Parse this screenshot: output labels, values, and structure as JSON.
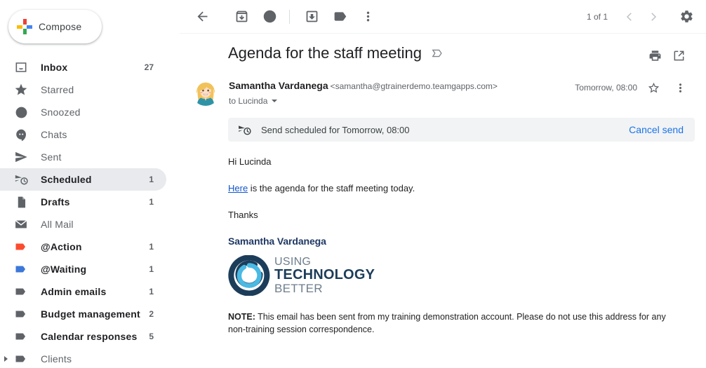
{
  "sidebar": {
    "compose": {
      "label": "Compose",
      "icon": "plus-icon"
    },
    "items": [
      {
        "label": "Inbox",
        "count": "27",
        "icon": "inbox-icon",
        "style": "bold",
        "expander": false
      },
      {
        "label": "Starred",
        "count": "",
        "icon": "star-icon",
        "style": "dim",
        "expander": false
      },
      {
        "label": "Snoozed",
        "count": "",
        "icon": "clock-icon",
        "style": "dim",
        "expander": false
      },
      {
        "label": "Chats",
        "count": "",
        "icon": "chat-icon",
        "style": "dim",
        "expander": false
      },
      {
        "label": "Sent",
        "count": "",
        "icon": "send-icon",
        "style": "dim",
        "expander": false
      },
      {
        "label": "Scheduled",
        "count": "1",
        "icon": "schedule-send-icon",
        "style": "bold selected",
        "expander": false
      },
      {
        "label": "Drafts",
        "count": "1",
        "icon": "draft-icon",
        "style": "bold",
        "expander": false
      },
      {
        "label": "All Mail",
        "count": "",
        "icon": "mail-stack-icon",
        "style": "dim",
        "expander": false
      },
      {
        "label": "@Action",
        "count": "1",
        "icon": "label-icon",
        "style": "bold",
        "expander": false,
        "color": "#fb4c2f"
      },
      {
        "label": "@Waiting",
        "count": "1",
        "icon": "label-icon",
        "style": "bold",
        "expander": false,
        "color": "#3c78d8"
      },
      {
        "label": "Admin emails",
        "count": "1",
        "icon": "label-icon",
        "style": "bold",
        "expander": false,
        "color": "#5f6368"
      },
      {
        "label": "Budget management",
        "count": "2",
        "icon": "label-icon",
        "style": "bold",
        "expander": false,
        "color": "#5f6368"
      },
      {
        "label": "Calendar responses",
        "count": "5",
        "icon": "label-icon",
        "style": "bold",
        "expander": false,
        "color": "#5f6368"
      },
      {
        "label": "Clients",
        "count": "",
        "icon": "label-icon",
        "style": "dim",
        "expander": true,
        "color": "#5f6368"
      }
    ]
  },
  "toolbar": {
    "back": "Back to Scheduled",
    "archive": "Archive",
    "snooze": "Snooze",
    "move_to_inbox": "Move to Inbox",
    "labels": "Labels",
    "more": "More",
    "page_count": "1 of 1",
    "prev": "Newer",
    "next": "Older",
    "settings": "Settings"
  },
  "message": {
    "subject": "Agenda for the staff meeting",
    "subject_label_icon": "label-outline-icon",
    "print_label": "Print all",
    "popout_label": "Open in new window",
    "sender_name": "Samantha Vardanega",
    "sender_email": "<samantha@gtrainerdemo.teamgapps.com>",
    "recipients": "to Lucinda",
    "time": "Tomorrow, 08:00",
    "star_label": "Star",
    "more_label": "More options",
    "scheduled_banner": {
      "icon": "schedule-send-icon",
      "text": "Send scheduled for Tomorrow, 08:00",
      "action": "Cancel send"
    },
    "body": {
      "greeting": "Hi Lucinda",
      "line2_link": "Here",
      "line2_rest": " is the agenda for the staff meeting today.",
      "closing": "Thanks",
      "signature_name": "Samantha Vardanega",
      "logo": {
        "line1": "USING",
        "line2": "TECHNOLOGY",
        "line3": "BETTER"
      },
      "note_label": "NOTE:",
      "note_text": " This email has been sent from my training demonstration account. Please do not use this address for any non-training session correspondence."
    }
  },
  "colors": {
    "accent_blue": "#1a73e8",
    "link_blue": "#1155cc",
    "selected_bg": "#e8eaed",
    "icon_grey": "#5f6368",
    "logo_dark": "#1c3d5a",
    "logo_light": "#4ab9e3",
    "signature_navy": "#1f3864",
    "label_red": "#fb4c2f",
    "label_blue": "#3c78d8"
  }
}
